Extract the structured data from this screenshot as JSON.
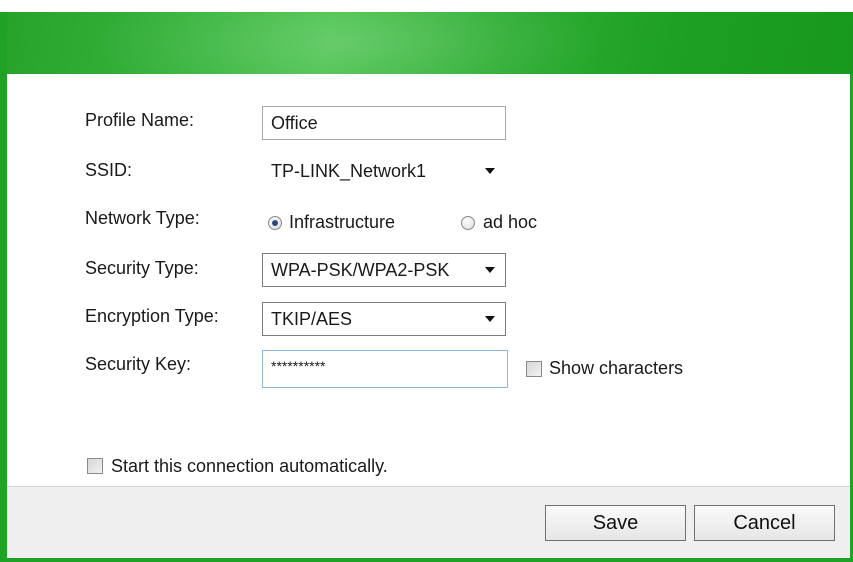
{
  "form": {
    "profile_name_label": "Profile Name:",
    "profile_name_value": "Office",
    "ssid_label": "SSID:",
    "ssid_value": "TP-LINK_Network1",
    "network_type_label": "Network Type:",
    "network_type_options": [
      "Infrastructure",
      "ad hoc"
    ],
    "network_type_selected": "Infrastructure",
    "security_type_label": "Security Type:",
    "security_type_value": "WPA-PSK/WPA2-PSK",
    "encryption_type_label": "Encryption Type:",
    "encryption_type_value": "TKIP/AES",
    "security_key_label": "Security Key:",
    "security_key_value": "**********",
    "show_characters_label": "Show characters",
    "show_characters_checked": false,
    "auto_connect_label": "Start this connection automatically.",
    "auto_connect_checked": false
  },
  "footer": {
    "save_label": "Save",
    "cancel_label": "Cancel"
  },
  "colors": {
    "accent_green": "#1fa226",
    "footer_bg": "#efefef"
  },
  "icons": {
    "dropdown": "chevron-down-icon",
    "radio": "radio-icon",
    "checkbox": "checkbox-icon"
  }
}
